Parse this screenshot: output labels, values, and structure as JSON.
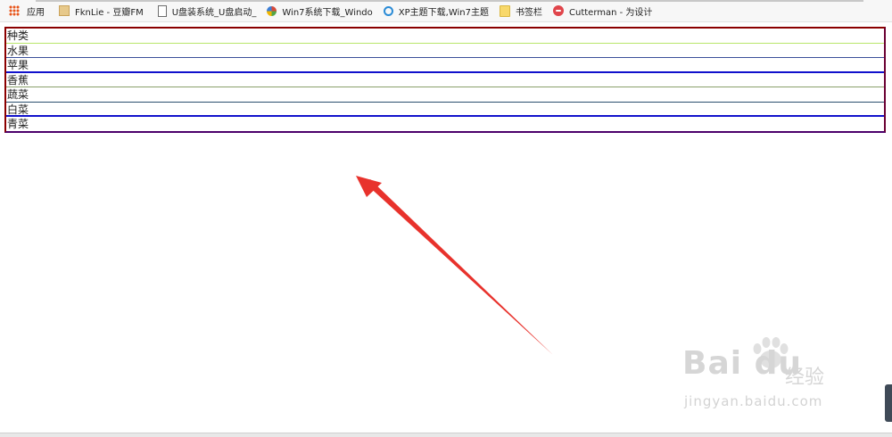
{
  "bookmarks": [
    {
      "label": "应用",
      "icon": "apps-grid-icon"
    },
    {
      "label": "FknLie - 豆瓣FM",
      "icon": "douban-fm-icon"
    },
    {
      "label": "U盘装系统_U盘启动_",
      "icon": "page-icon"
    },
    {
      "label": "Win7系统下载_Windo",
      "icon": "windows-logo-icon"
    },
    {
      "label": "XP主题下载,Win7主题",
      "icon": "ie-icon"
    },
    {
      "label": "书签栏",
      "icon": "folder-icon"
    },
    {
      "label": "Cutterman - 为设计",
      "icon": "cutterman-icon"
    }
  ],
  "list": {
    "rows": [
      "种类",
      "水果",
      "苹果",
      "香蕉",
      "蔬菜",
      "白菜",
      "青菜"
    ]
  },
  "annotation": {
    "arrow_color": "#e8322c"
  },
  "watermark": {
    "brand": "Bai du",
    "cn": "经验",
    "url": "jingyan.baidu.com"
  }
}
